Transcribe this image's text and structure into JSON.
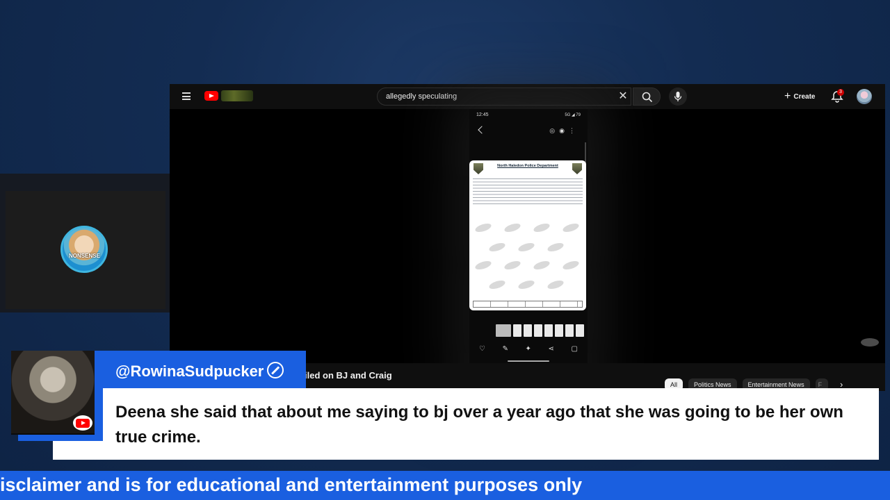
{
  "search": {
    "query": "allegedly speculating"
  },
  "topbar": {
    "create_label": "Create",
    "notification_count": "3"
  },
  "phone": {
    "status_time": "12:45",
    "status_right": "5G ◢ 79"
  },
  "document": {
    "title": "North Haledon Police Department"
  },
  "video": {
    "title_fragment": "iled on BJ and Craig"
  },
  "chips": [
    "All",
    "Politics News",
    "Entertainment News",
    "F"
  ],
  "chat": {
    "username": "@RowinaSudpucker",
    "message": "Deena she said that about me saying to bj over a year ago that she was going to be her own true crime."
  },
  "webcam": {
    "badge_text": "NONSENSE"
  },
  "ticker": {
    "text": "isclaimer and is for educational and entertainment purposes only"
  },
  "colors": {
    "accent_blue": "#1a5fe0",
    "youtube_red": "#ff0000",
    "background_navy": "#132c52"
  },
  "icons": [
    "hamburger-icon",
    "youtube-logo-icon",
    "clear-icon",
    "search-icon",
    "mic-icon",
    "plus-icon",
    "bell-icon",
    "moderator-icon",
    "chevron-right-icon"
  ]
}
